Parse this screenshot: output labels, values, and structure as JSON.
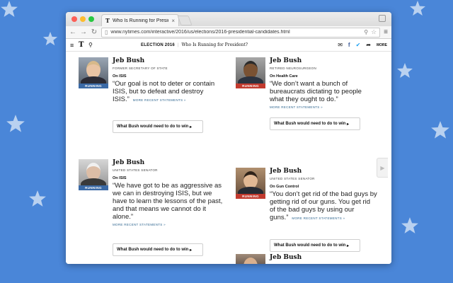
{
  "browser": {
    "tab_title": "Who Is Running for Preside",
    "tab_favicon": "T",
    "url": "www.nytimes.com/interactive/2016/us/elections/2016-presidential-candidates.html"
  },
  "nyt_header": {
    "logo": "T",
    "section": "ELECTION 2016",
    "kicker": "Who Is Running for President?",
    "more": "MORE"
  },
  "cards": [
    {
      "name": "Jeb Bush",
      "role": "FORMER SECRETARY OF STATE",
      "topic": "On ISIS",
      "quote": "“Our goal is not to deter or contain ISIS, but to defeat and destroy ISIS.”",
      "more": "MORE RECENT STATEMENTS »",
      "badge": "RUNNING",
      "button": "What Bush would need to do to win"
    },
    {
      "name": "Jeb Bush",
      "role": "RETIRED NEUROSURGEON",
      "topic": "On Health Care",
      "quote": "“We don’t want a bunch of bureaucrats dictating to people what they ought to do.”",
      "more": "MORE RECENT STATEMENTS »",
      "badge": "RUNNING",
      "button": "What Bush would need to do to win"
    },
    {
      "name": "Jeb Bush",
      "role": "UNITED STATES SENATOR",
      "topic": "On ISIS",
      "quote": "“We have got to be as aggressive as we can in destroying ISIS, but we have to learn the lessons of the past, and that means we cannot do it alone.”",
      "more": "MORE RECENT STATEMENTS »",
      "badge": "RUNNING",
      "button": "What Bush would need to do to win"
    },
    {
      "name": "Jeb Bush",
      "role": "UNITED STATES SENATOR",
      "topic": "On Gun Control",
      "quote": "“You don’t get rid of the bad guys by getting rid of our guns. You get rid of the bad guys by using our guns.”",
      "more": "MORE RECENT STATEMENTS »",
      "badge": "RUNNING",
      "button": "What Bush would need to do to win"
    },
    {
      "name": "Jeb Bush"
    }
  ],
  "colors": {
    "background": "#4a86d8",
    "badge_blue": "#3b6aa6",
    "badge_red": "#c23a2e"
  }
}
